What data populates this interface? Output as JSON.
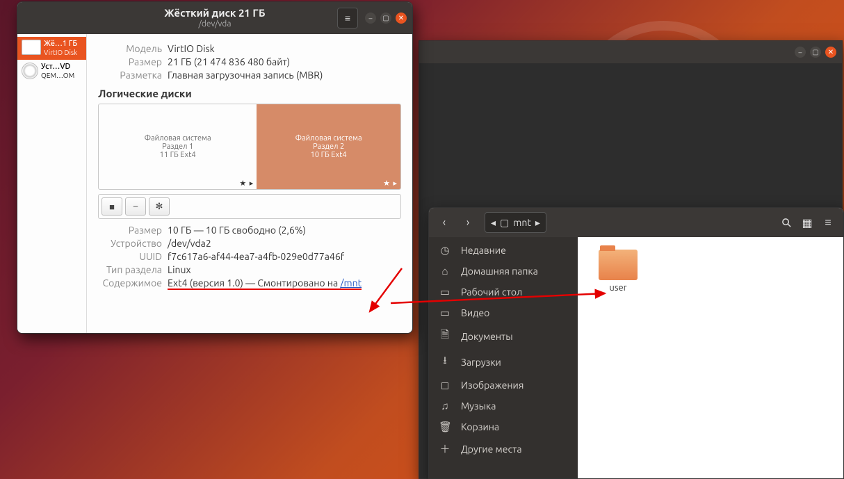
{
  "disks": {
    "title": "Жёсткий диск 21 ГБ",
    "subtitle": "/dev/vda",
    "sidebar": [
      {
        "line1": "Жё…1 ГБ",
        "line2": "VirtIO Disk",
        "selected": true,
        "icon": "hdd"
      },
      {
        "line1": "Уст…VD",
        "line2": "QEM…OM",
        "selected": false,
        "icon": "cd"
      }
    ],
    "info": {
      "model_label": "Модель",
      "model": "VirtIO Disk",
      "size_label": "Размер",
      "size": "21 ГБ (21 474 836 480 байт)",
      "parttable_label": "Разметка",
      "parttable": "Главная загрузочная запись (MBR)"
    },
    "volumes_header": "Логические диски",
    "partitions": [
      {
        "fs": "Файловая система",
        "name": "Раздел 1",
        "sz": "11 ГБ Ext4",
        "selected": false
      },
      {
        "fs": "Файловая система",
        "name": "Раздел 2",
        "sz": "10 ГБ Ext4",
        "selected": true
      }
    ],
    "toolbar": {
      "stop": "■",
      "minus": "–",
      "gear": "✻"
    },
    "selected": {
      "size_label": "Размер",
      "size": "10 ГБ — 10 ГБ свободно (2,6%)",
      "device_label": "Устройство",
      "device": "/dev/vda2",
      "uuid_label": "UUID",
      "uuid": "f7c617a6-af44-4ea7-a4fb-029e0d77a46f",
      "type_label": "Тип раздела",
      "type": "Linux",
      "content_label": "Содержимое",
      "content_prefix": "Ext4 (версия 1.0) — Смонтировано на ",
      "mount_link": "/mnt"
    }
  },
  "files": {
    "breadcrumb": "mnt",
    "sidebar": [
      {
        "icon": "◷",
        "label": "Недавние"
      },
      {
        "icon": "⌂",
        "label": "Домашняя папка"
      },
      {
        "icon": "▭",
        "label": "Рабочий стол"
      },
      {
        "icon": "▭",
        "label": "Видео"
      },
      {
        "icon": "🗎",
        "label": "Документы"
      },
      {
        "icon": "⭳",
        "label": "Загрузки"
      },
      {
        "icon": "◻",
        "label": "Изображения"
      },
      {
        "icon": "♫",
        "label": "Музыка"
      },
      {
        "icon": "🗑",
        "label": "Корзина"
      },
      {
        "icon": "＋",
        "label": "Другие места"
      }
    ],
    "folder_name": "user"
  }
}
